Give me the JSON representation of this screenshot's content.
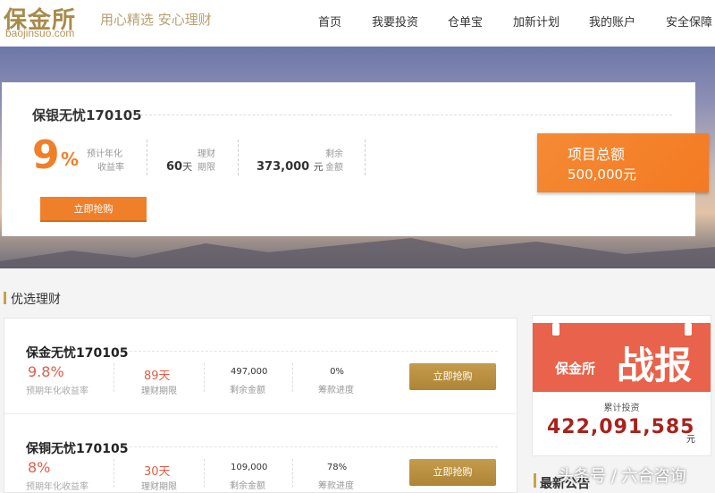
{
  "header": {
    "logo": "保金所",
    "domain": "baojinsuo.com",
    "slogan": "用心精选 安心理财",
    "nav": [
      "首页",
      "我要投资",
      "仓单宝",
      "加新计划",
      "我的账户",
      "安全保障"
    ]
  },
  "featured": {
    "title": "保银无忧170105",
    "rate": "9",
    "rate_unit": "%",
    "rate_label": [
      "预计年化",
      "收益率"
    ],
    "term_value": "60",
    "term_unit": "天",
    "term_label": [
      "理财",
      "期限"
    ],
    "remaining_value": "373,000",
    "remaining_unit": "元",
    "remaining_label": [
      "剩余",
      "金额"
    ],
    "button": "立即抢购",
    "total_label": "项目总额",
    "total_value": "500,000元"
  },
  "section_title": "优选理财",
  "products": [
    {
      "name": "保金无忧170105",
      "rate": "9.8%",
      "rate_label": "预期年化收益率",
      "days": "89天",
      "days_label": "理财期限",
      "amount": "497,000",
      "amount_label": "剩余金额",
      "progress": "0%",
      "progress_label": "筹款进度",
      "button": "立即抢购"
    },
    {
      "name": "保铜无忧170105",
      "rate": "8%",
      "rate_label": "预期年化收益率",
      "days": "30天",
      "days_label": "理财期限",
      "amount": "109,000",
      "amount_label": "剩余金额",
      "progress": "78%",
      "progress_label": "筹款进度",
      "button": "立即抢购"
    }
  ],
  "report": {
    "logo": "保金所",
    "title": "战报",
    "label": "累计投资",
    "value": "422,091,585",
    "unit": "元"
  },
  "notice": "最新公告",
  "watermark": "头条号 / 六合咨询",
  "colors": {
    "accent_orange": "#f07f2a",
    "gold": "#b8913f",
    "rate_red": "#e05d48",
    "report_red": "#e9624b"
  }
}
